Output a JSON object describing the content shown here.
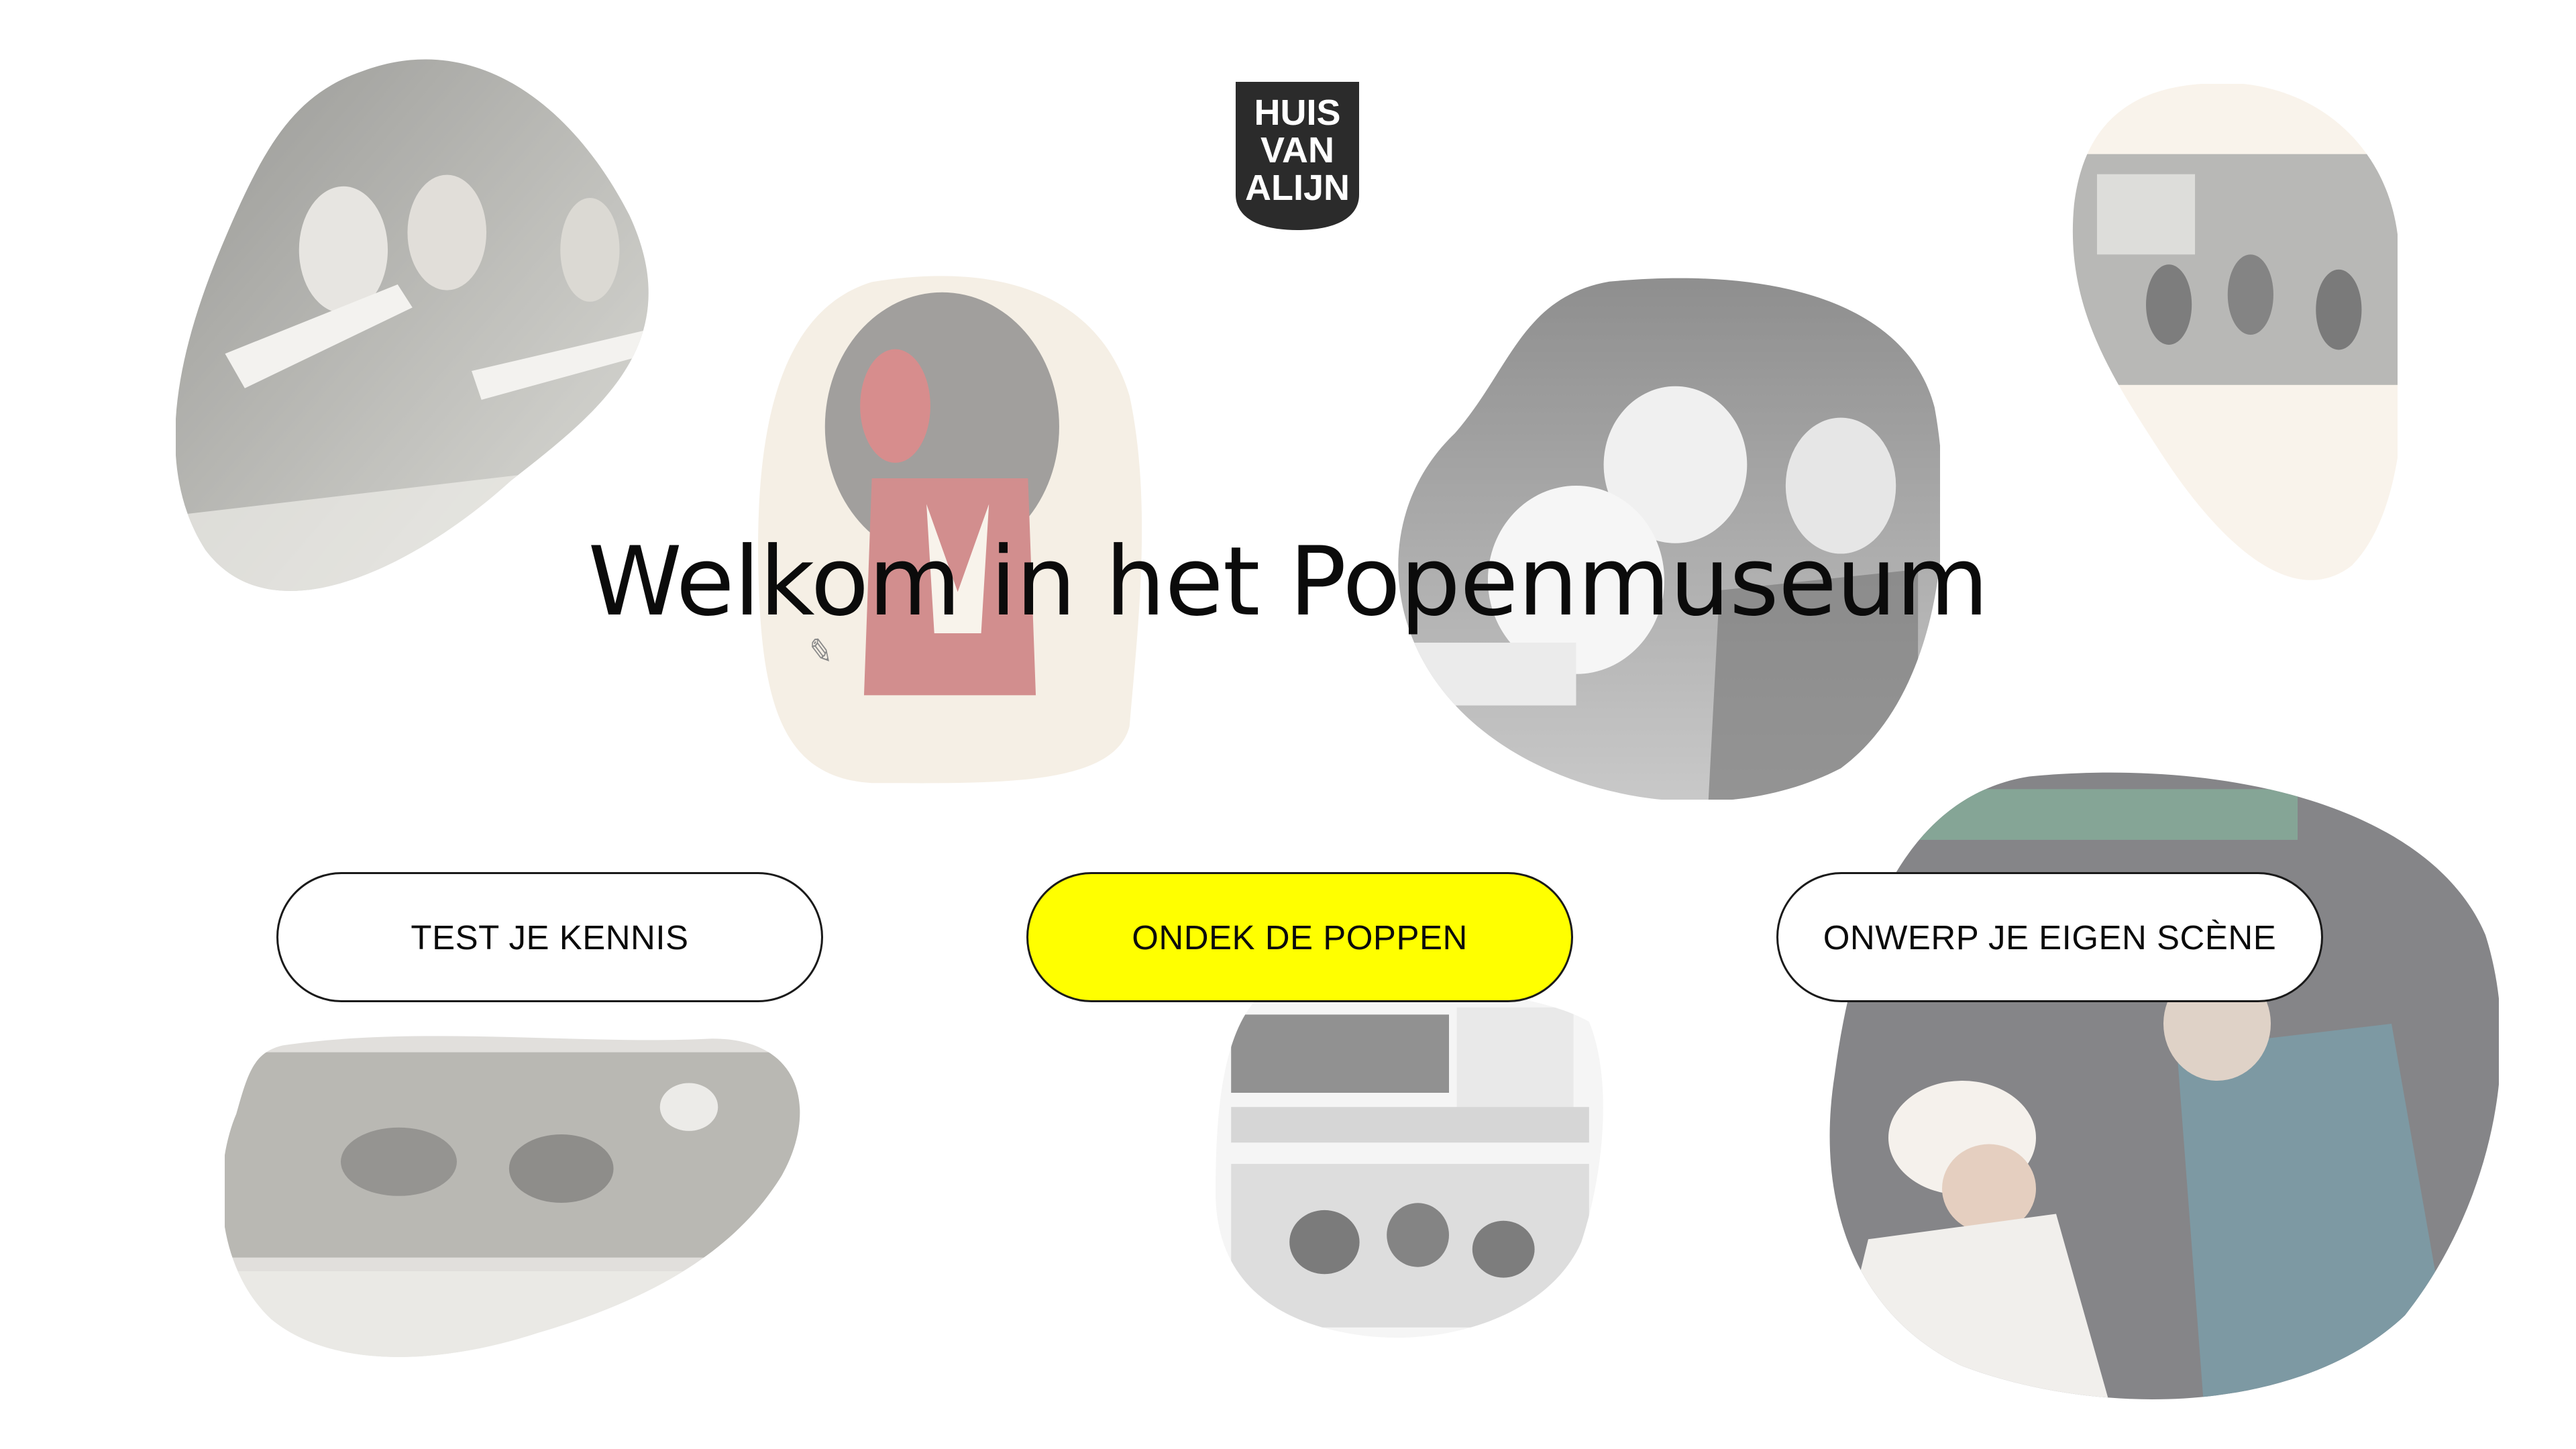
{
  "brand": {
    "logo_line1": "HUIS",
    "logo_line2": "VAN",
    "logo_line3": "ALIJN",
    "logo_color": "#2b2b2b"
  },
  "hero": {
    "title": "Welkom in het Popenmuseum"
  },
  "actions": {
    "quiz_label": "TEST JE KENNIS",
    "discover_label": "ONDEK DE POPPEN",
    "design_label": "ONWERP JE EIGEN SCÈNE",
    "highlight_color": "#ffff00"
  },
  "images": [
    "puppeteers-photo",
    "devil-puppet-drawing",
    "puppet-show-photo",
    "group-with-puppets-photo",
    "chef-puppet-photo",
    "puppet-stage-photo",
    "newspaper-cartoon-clipping"
  ]
}
